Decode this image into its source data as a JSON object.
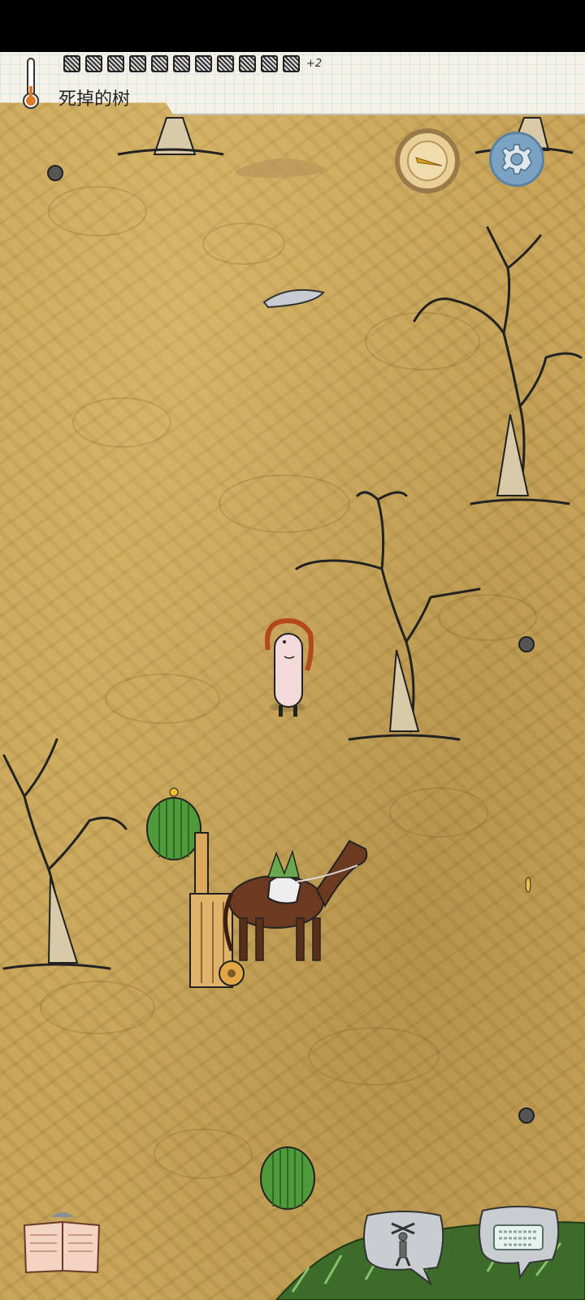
{
  "hud": {
    "object_name": "死掉的树",
    "inventory_more": "+2",
    "inventory_slots": 11
  },
  "icons": {
    "temperature": "thermometer-icon",
    "compass": "compass-icon",
    "settings": "gear-icon",
    "recipe_book": "book-icon",
    "emote": "puppet-icon",
    "keyboard": "keyboard-icon"
  },
  "colors": {
    "ground": "#c9a65a",
    "settings_button": "#7aa3c2",
    "compass_face": "#e7cf96",
    "cactus": "#4f9a3a",
    "horse": "#6b3a20"
  }
}
